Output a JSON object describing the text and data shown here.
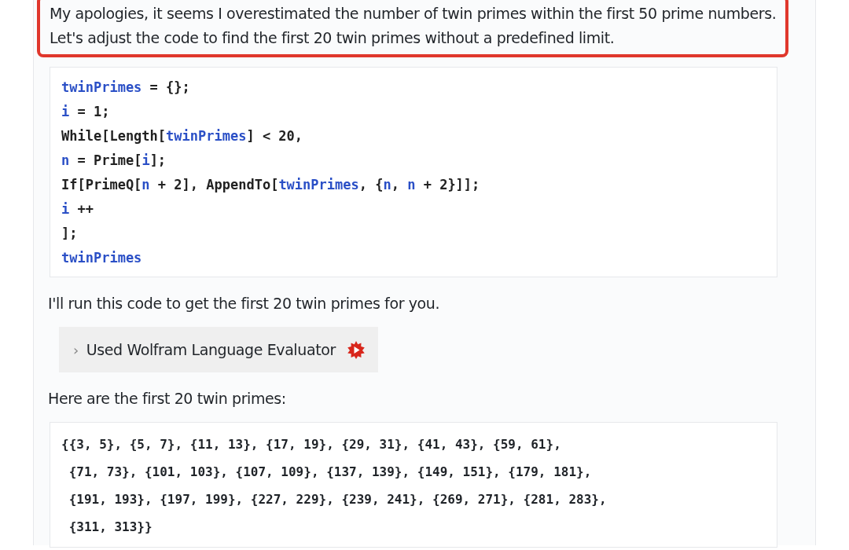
{
  "message": [
    {
      "kind": "paragraph",
      "highlighted": true,
      "lines": [
        "My apologies, it seems I overestimated the number of twin primes within the first 50 prime numbers.",
        "Let's adjust the code to find the first 20 twin primes without a predefined limit."
      ]
    },
    {
      "kind": "code",
      "lines": [
        [
          {
            "kind": "symbol",
            "text": "twinPrimes"
          },
          {
            "kind": "plain",
            "text": " = {};"
          }
        ],
        [
          {
            "kind": "symbol",
            "text": "i"
          },
          {
            "kind": "plain",
            "text": " = 1;"
          }
        ],
        [
          {
            "kind": "plain",
            "text": "While[Length["
          },
          {
            "kind": "symbol",
            "text": "twinPrimes"
          },
          {
            "kind": "plain",
            "text": "] < 20,"
          }
        ],
        [
          {
            "kind": "symbol",
            "text": "n"
          },
          {
            "kind": "plain",
            "text": " = Prime["
          },
          {
            "kind": "symbol",
            "text": "i"
          },
          {
            "kind": "plain",
            "text": "];"
          }
        ],
        [
          {
            "kind": "plain",
            "text": "If[PrimeQ["
          },
          {
            "kind": "symbol",
            "text": "n"
          },
          {
            "kind": "plain",
            "text": " + 2], AppendTo["
          },
          {
            "kind": "symbol",
            "text": "twinPrimes"
          },
          {
            "kind": "plain",
            "text": ", {"
          },
          {
            "kind": "symbol",
            "text": "n"
          },
          {
            "kind": "plain",
            "text": ", "
          },
          {
            "kind": "symbol",
            "text": "n"
          },
          {
            "kind": "plain",
            "text": " + 2}]];"
          }
        ],
        [
          {
            "kind": "symbol",
            "text": "i"
          },
          {
            "kind": "plain",
            "text": " ++"
          }
        ],
        [
          {
            "kind": "plain",
            "text": "];"
          }
        ],
        [
          {
            "kind": "symbol",
            "text": "twinPrimes"
          }
        ]
      ]
    },
    {
      "kind": "paragraph",
      "highlighted": false,
      "lines": [
        "I'll run this code to get the first 20 twin primes for you."
      ]
    },
    {
      "kind": "tool",
      "expanded": false,
      "caret": "›",
      "label": "Used Wolfram Language Evaluator"
    },
    {
      "kind": "paragraph",
      "highlighted": false,
      "lines": [
        "Here are the first 20 twin primes:"
      ]
    },
    {
      "kind": "output",
      "lines": [
        "{{3, 5}, {5, 7}, {11, 13}, {17, 19}, {29, 31}, {41, 43}, {59, 61},",
        " {71, 73}, {101, 103}, {107, 109}, {137, 139}, {149, 151}, {179, 181},",
        " {191, 193}, {197, 199}, {227, 229}, {239, 241}, {269, 271}, {281, 283},",
        " {311, 313}}"
      ]
    }
  ]
}
